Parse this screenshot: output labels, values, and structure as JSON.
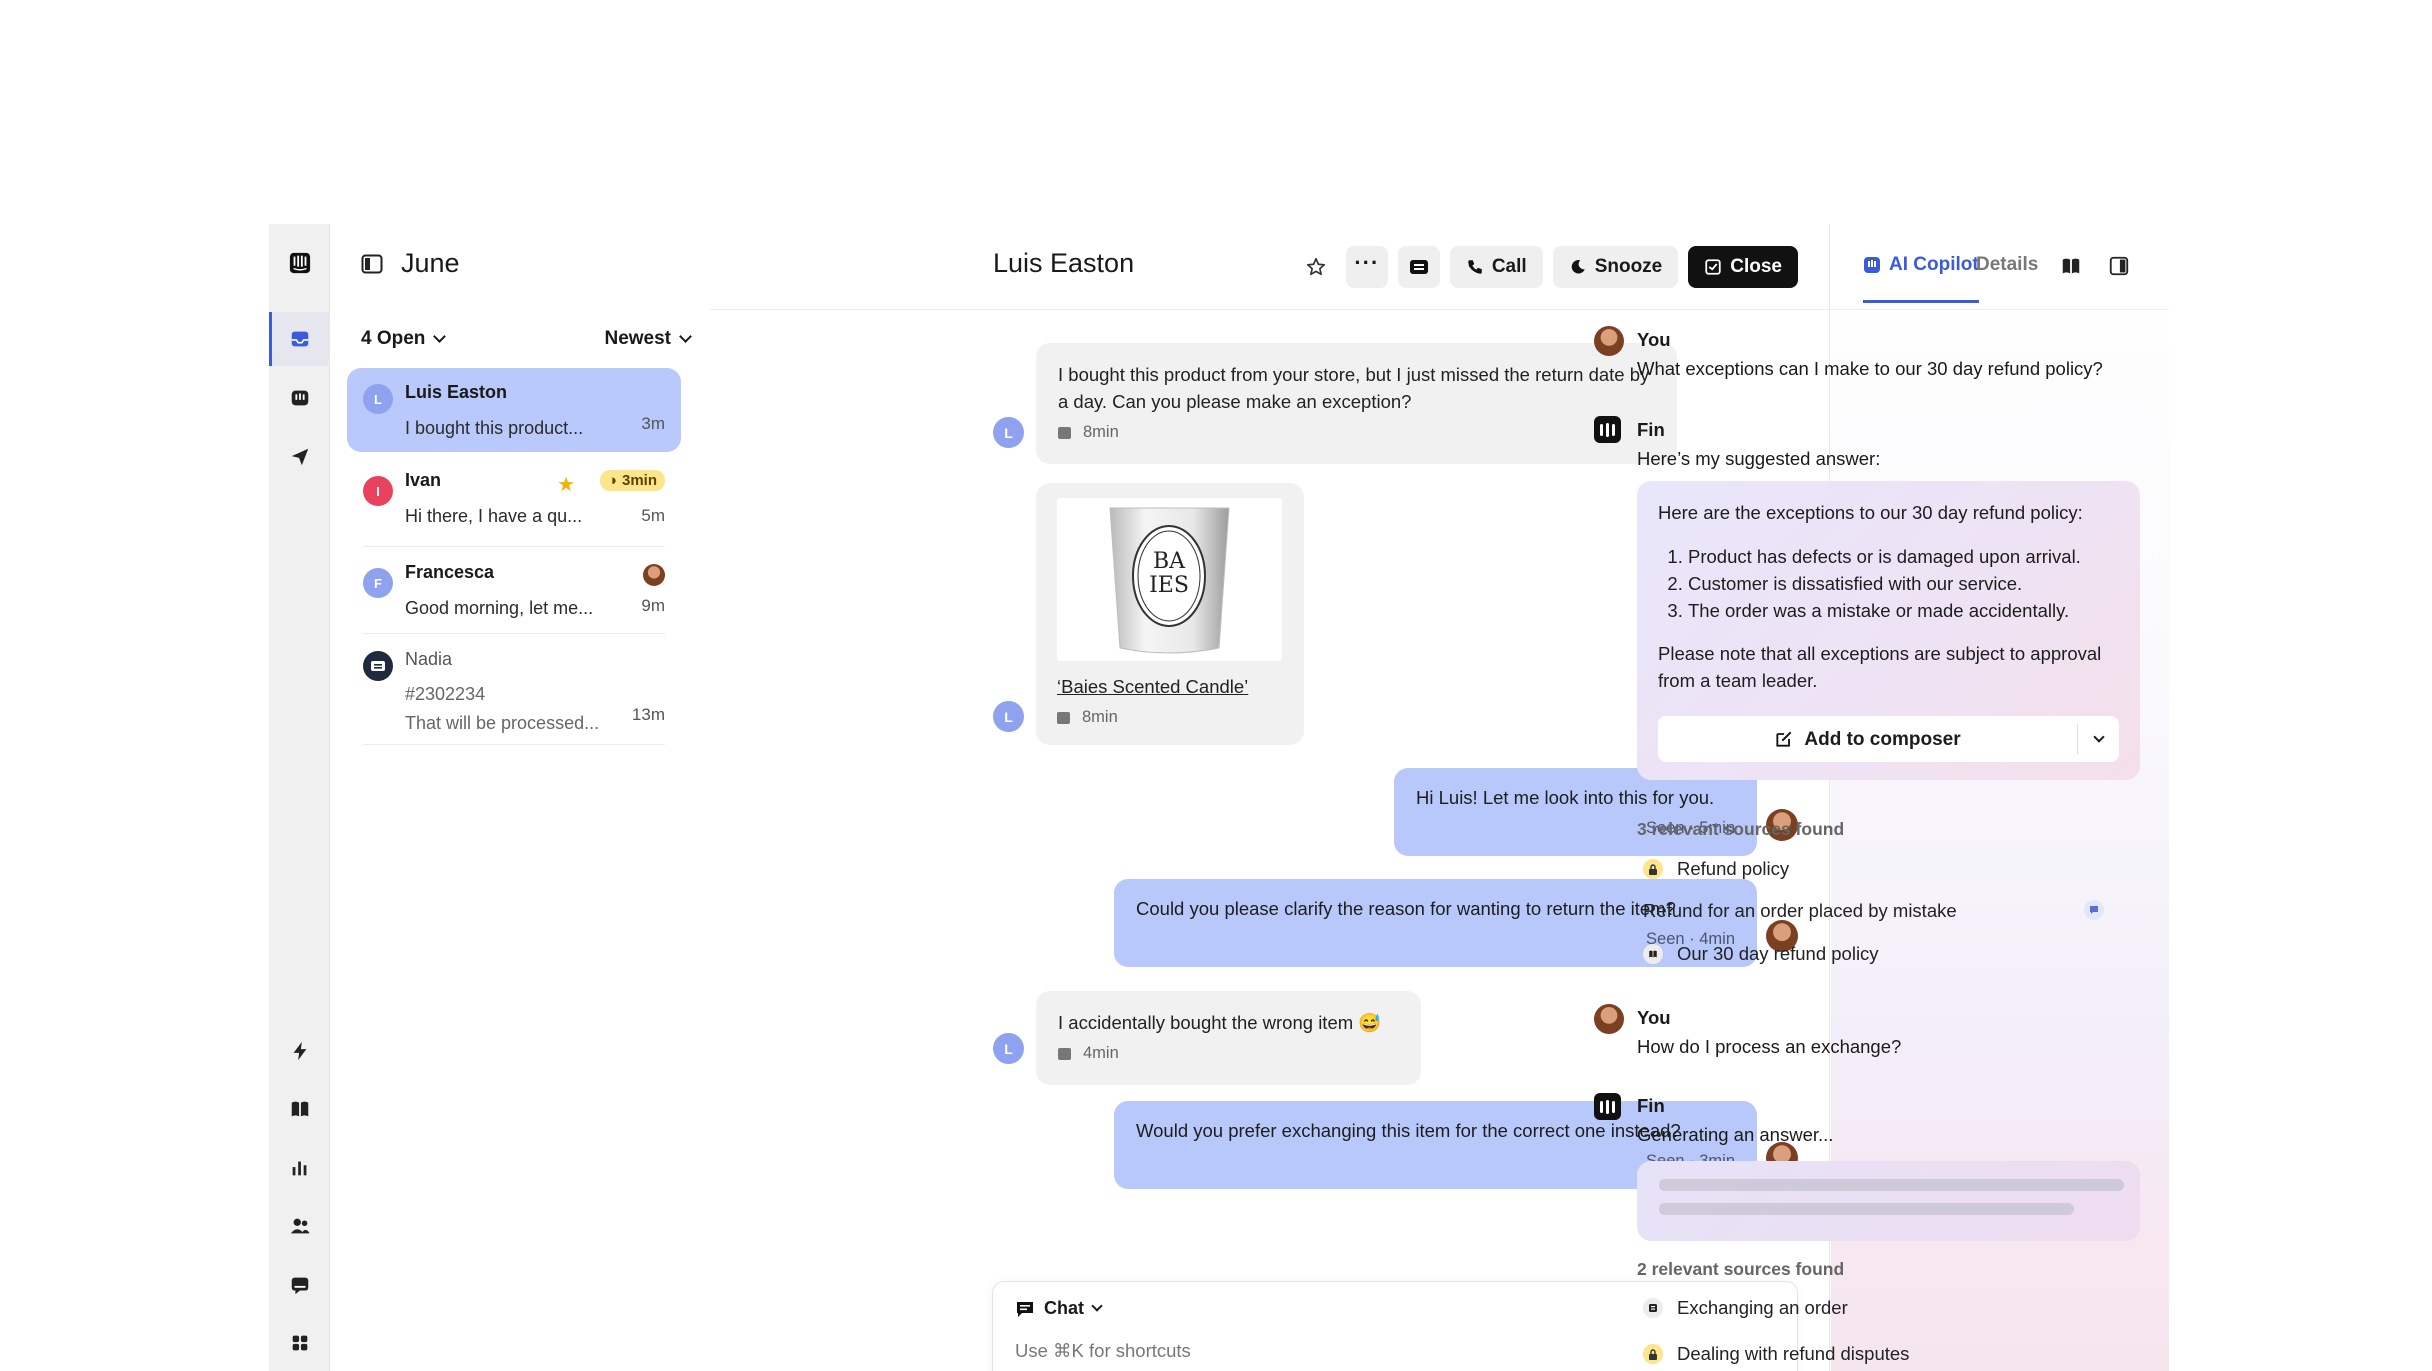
{
  "inbox": {
    "title": "June",
    "filter_open": "4 Open",
    "sort": "Newest"
  },
  "conversations": [
    {
      "initial": "L",
      "name": "Luis Easton",
      "preview": "I bought this product...",
      "time": "3m",
      "color": "#8ea2f0"
    },
    {
      "initial": "I",
      "name": "Ivan",
      "preview": "Hi there, I have a qu...",
      "time": "5m",
      "color": "#e8435e",
      "snooze": "3min",
      "starred": true
    },
    {
      "initial": "F",
      "name": "Francesca",
      "preview": "Good morning, let me...",
      "time": "9m",
      "color": "#8ea2f0"
    },
    {
      "initial": "",
      "name": "Nadia",
      "ticket": "#2302234",
      "preview": "That will be processed...",
      "time": "13m",
      "color": "#1f2a3f"
    }
  ],
  "chat": {
    "title": "Luis Easton",
    "buttons": {
      "call": "Call",
      "snooze": "Snooze",
      "close": "Close"
    },
    "messages": [
      {
        "dir": "in",
        "avatar": "L",
        "text": "I bought this product from your store, but I just missed the return date by a day. Can you please make an exception?",
        "meta": "8min"
      },
      {
        "dir": "in",
        "avatar": "L",
        "product_link": "‘Baies Scented Candle’",
        "meta": "8min"
      },
      {
        "dir": "out",
        "text": "Hi Luis! Let me look into this for you.",
        "meta": "Seen · 5min"
      },
      {
        "dir": "out",
        "text": "Could you please clarify the reason for wanting to return the item?",
        "meta": "Seen · 4min"
      },
      {
        "dir": "in",
        "avatar": "L",
        "text": "I accidentally bought the wrong item 😅",
        "meta": "4min"
      },
      {
        "dir": "out",
        "text": "Would you prefer exchanging this item for the correct one instead?",
        "meta": "Seen · 3min"
      }
    ],
    "composer": {
      "mode": "Chat",
      "placeholder": "Use ⌘K for shortcuts"
    }
  },
  "copilot": {
    "tabs": {
      "copilot": "AI Copilot",
      "details": "Details"
    },
    "q1": {
      "who": "You",
      "text": "What exceptions can I make to our 30 day refund policy?"
    },
    "a1": {
      "who": "Fin",
      "intro": "Here’s my suggested answer:",
      "card_lead": "Here are the exceptions to our 30 day refund policy:",
      "items": [
        "Product has defects or is damaged upon arrival.",
        "Customer is dissatisfied with our service.",
        "The order was a mistake or made accidentally."
      ],
      "card_note": "Please note that all exceptions are subject to approval from a team leader.",
      "add_button": "Add to composer",
      "sources_title": "3 relevant sources found",
      "sources": [
        "Refund policy",
        "Refund for an order placed by mistake",
        "Our 30 day refund policy"
      ]
    },
    "q2": {
      "who": "You",
      "text": "How do I process an exchange?"
    },
    "a2": {
      "who": "Fin",
      "status": "Generating an answer...",
      "sources_title": "2 relevant sources found",
      "sources": [
        "Exchanging an order",
        "Dealing with refund disputes"
      ]
    }
  },
  "colors": {
    "accent": "#3a5bdc",
    "bubble_out": "#b8c8fb",
    "selected": "#b9c9fb",
    "snooze_badge": "#fde58a"
  }
}
